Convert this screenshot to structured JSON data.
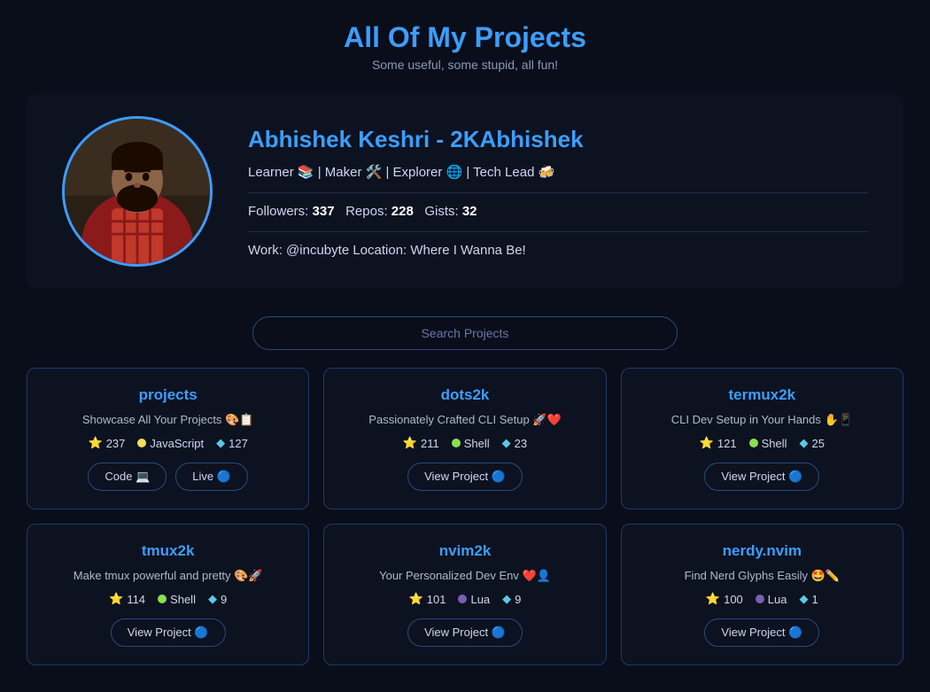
{
  "header": {
    "title": "All Of My Projects",
    "subtitle": "Some useful, some stupid, all fun!"
  },
  "profile": {
    "name": "Abhishek Keshri - 2KAbhishek",
    "tagline": "Learner 📚 | Maker 🛠️ | Explorer 🌐 | Tech Lead 🍻",
    "followers_label": "Followers:",
    "followers": "337",
    "repos_label": "Repos:",
    "repos": "228",
    "gists_label": "Gists:",
    "gists": "32",
    "work": "Work: @incubyte  Location: Where I Wanna Be!"
  },
  "search": {
    "placeholder": "Search Projects"
  },
  "projects": [
    {
      "name": "projects",
      "desc": "Showcase All Your Projects 🎨📋",
      "stars": "237",
      "lang": "JavaScript",
      "lang_type": "js",
      "forks": "127",
      "buttons": [
        "Code 💻",
        "Live 🔵"
      ]
    },
    {
      "name": "dots2k",
      "desc": "Passionately Crafted CLI Setup 🚀❤️",
      "stars": "211",
      "lang": "Shell",
      "lang_type": "shell",
      "forks": "23",
      "buttons": [
        "View Project 🔵"
      ]
    },
    {
      "name": "termux2k",
      "desc": "CLI Dev Setup in Your Hands ✋📱",
      "stars": "121",
      "lang": "Shell",
      "lang_type": "shell",
      "forks": "25",
      "buttons": [
        "View Project 🔵"
      ]
    },
    {
      "name": "tmux2k",
      "desc": "Make tmux powerful and pretty 🎨🚀",
      "stars": "114",
      "lang": "Shell",
      "lang_type": "shell",
      "forks": "9",
      "buttons": [
        "View Project 🔵"
      ]
    },
    {
      "name": "nvim2k",
      "desc": "Your Personalized Dev Env ❤️👤",
      "stars": "101",
      "lang": "Lua",
      "lang_type": "lua",
      "forks": "9",
      "buttons": [
        "View Project 🔵"
      ]
    },
    {
      "name": "nerdy.nvim",
      "desc": "Find Nerd Glyphs Easily 🤩✏️",
      "stars": "100",
      "lang": "Lua",
      "lang_type": "lua",
      "forks": "1",
      "buttons": [
        "View Project 🔵"
      ]
    }
  ]
}
